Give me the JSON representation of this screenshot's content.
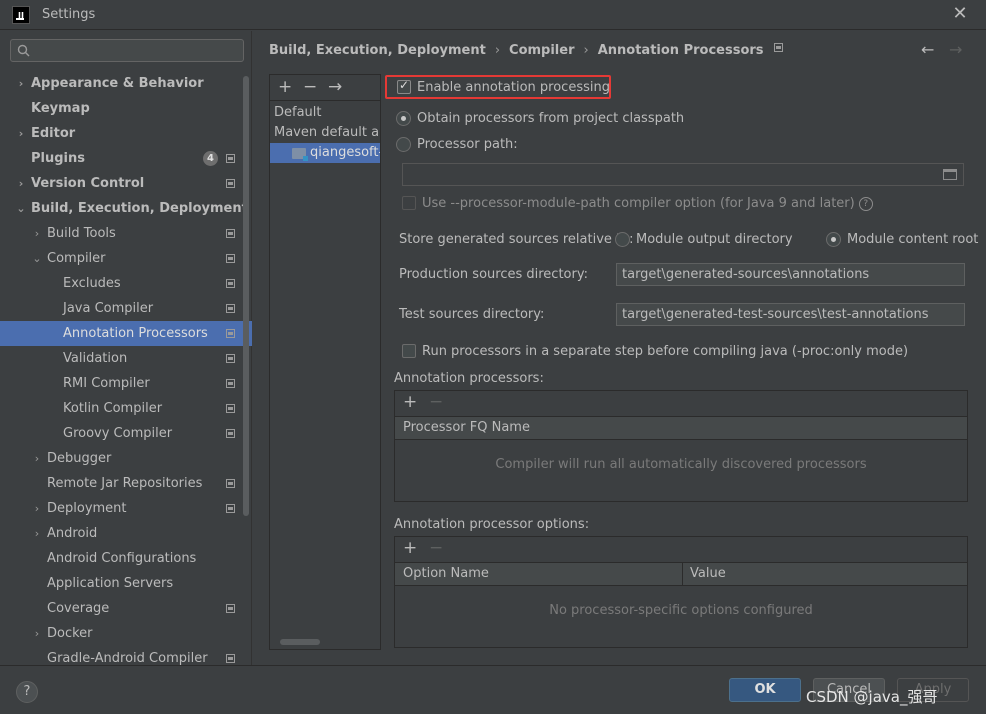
{
  "window": {
    "title": "Settings",
    "app_icon": "IJ"
  },
  "search": {
    "placeholder": "",
    "value": ""
  },
  "sidebar": {
    "items": [
      {
        "label": "Appearance & Behavior",
        "arrow": "›",
        "bold": true
      },
      {
        "label": "Keymap",
        "bold": true
      },
      {
        "label": "Editor",
        "arrow": "›",
        "bold": true
      },
      {
        "label": "Plugins",
        "bold": true,
        "badge": "4"
      },
      {
        "label": "Version Control",
        "arrow": "›",
        "bold": true
      },
      {
        "label": "Build, Execution, Deployment",
        "arrow": "⌄",
        "bold": true
      },
      {
        "label": "Build Tools",
        "arrow": "›"
      },
      {
        "label": "Compiler",
        "arrow": "⌄"
      },
      {
        "label": "Excludes"
      },
      {
        "label": "Java Compiler"
      },
      {
        "label": "Annotation Processors",
        "selected": true
      },
      {
        "label": "Validation"
      },
      {
        "label": "RMI Compiler"
      },
      {
        "label": "Kotlin Compiler"
      },
      {
        "label": "Groovy Compiler"
      },
      {
        "label": "Debugger",
        "arrow": "›"
      },
      {
        "label": "Remote Jar Repositories"
      },
      {
        "label": "Deployment",
        "arrow": "›"
      },
      {
        "label": "Android",
        "arrow": "›"
      },
      {
        "label": "Android Configurations"
      },
      {
        "label": "Application Servers"
      },
      {
        "label": "Coverage"
      },
      {
        "label": "Docker",
        "arrow": "›"
      },
      {
        "label": "Gradle-Android Compiler"
      }
    ]
  },
  "breadcrumb": {
    "items": [
      "Build, Execution, Deployment",
      "Compiler",
      "Annotation Processors"
    ],
    "separator": "›",
    "back": "←",
    "forward": "→"
  },
  "profiles": {
    "toolbar": {
      "add": "+",
      "remove": "−",
      "move": "→"
    },
    "items": [
      "Default",
      "Maven default annotation processors profile",
      "qiangesoft-demo"
    ]
  },
  "settings": {
    "enable_annotation_processing": "Enable annotation processing",
    "obtain_from_classpath": "Obtain processors from project classpath",
    "processor_path": "Processor path:",
    "processor_path_value": "",
    "use_module_path": "Use --processor-module-path compiler option (for Java 9 and later)",
    "help_glyph": "?",
    "store_relative_label": "Store generated sources relative to:",
    "module_output_directory": "Module output directory",
    "module_content_root": "Module content root",
    "production_sources_label": "Production sources directory:",
    "production_sources_value": "target\\generated-sources\\annotations",
    "test_sources_label": "Test sources directory:",
    "test_sources_value": "target\\generated-test-sources\\test-annotations",
    "run_separate_step": "Run processors in a separate step before compiling java (-proc:only mode)"
  },
  "annotation_processors": {
    "title": "Annotation processors:",
    "add": "+",
    "remove": "−",
    "column": "Processor FQ Name",
    "empty_text": "Compiler will run all automatically discovered processors"
  },
  "processor_options": {
    "title": "Annotation processor options:",
    "add": "+",
    "remove": "−",
    "columns": [
      "Option Name",
      "Value"
    ],
    "empty_text": "No processor-specific options configured"
  },
  "footer": {
    "help": "?",
    "ok": "OK",
    "cancel": "Cancel",
    "apply": "Apply",
    "watermark": "CSDN @java_强哥"
  },
  "colors": {
    "background": "#3c3f41",
    "selection": "#4b6eaf",
    "primary_button": "#365880",
    "highlight_border": "#e53935"
  }
}
